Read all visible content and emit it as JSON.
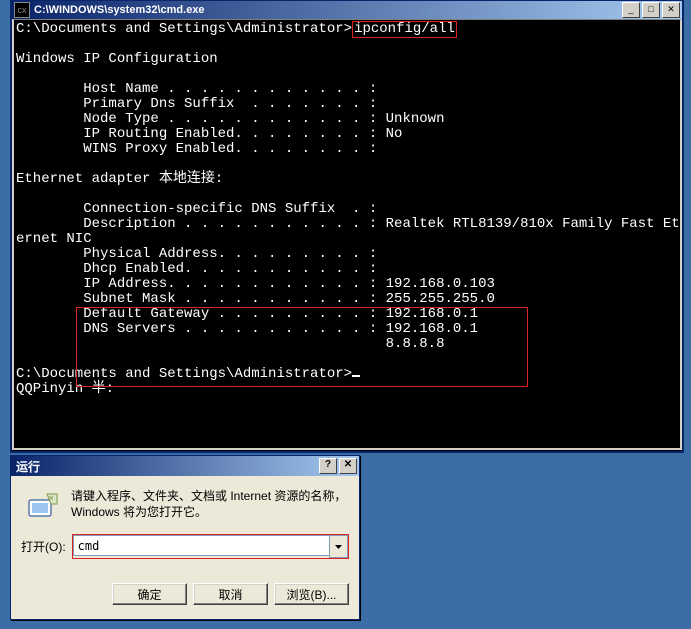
{
  "cmd": {
    "title": "C:\\WINDOWS\\system32\\cmd.exe",
    "prompt1_path": "C:\\Documents and Settings\\Administrator>",
    "prompt1_cmd": "ipconfig/all",
    "section_header": "Windows IP Configuration",
    "lines_top": [
      "        Host Name . . . . . . . . . . . . :",
      "        Primary Dns Suffix  . . . . . . . :",
      "        Node Type . . . . . . . . . . . . : Unknown",
      "        IP Routing Enabled. . . . . . . . : No",
      "        WINS Proxy Enabled. . . . . . . . :"
    ],
    "adapter_header": "Ethernet adapter 本地连接:",
    "lines_adapter_pre": [
      "        Connection-specific DNS Suffix  . :",
      "        Description . . . . . . . . . . . : Realtek RTL8139/810x Family Fast Eth",
      "ernet NIC",
      "        Physical Address. . . . . . . . . :",
      "        Dhcp Enabled. . . . . . . . . . . :"
    ],
    "boxed_lines": [
      "        IP Address. . . . . . . . . . . . : 192.168.0.103",
      "        Subnet Mask . . . . . . . . . . . : 255.255.255.0",
      "        Default Gateway . . . . . . . . . : 192.168.0.1",
      "        DNS Servers . . . . . . . . . . . : 192.168.0.1",
      "                                            8.8.8.8"
    ],
    "prompt2": "C:\\Documents and Settings\\Administrator>",
    "ime_line": "QQPinyin 半:"
  },
  "run": {
    "title": "运行",
    "desc": "请键入程序、文件夹、文档或 Internet 资源的名称，Windows 将为您打开它。",
    "open_label": "打开(O):",
    "input_value": "cmd",
    "ok": "确定",
    "cancel": "取消",
    "browse": "浏览(B)..."
  }
}
